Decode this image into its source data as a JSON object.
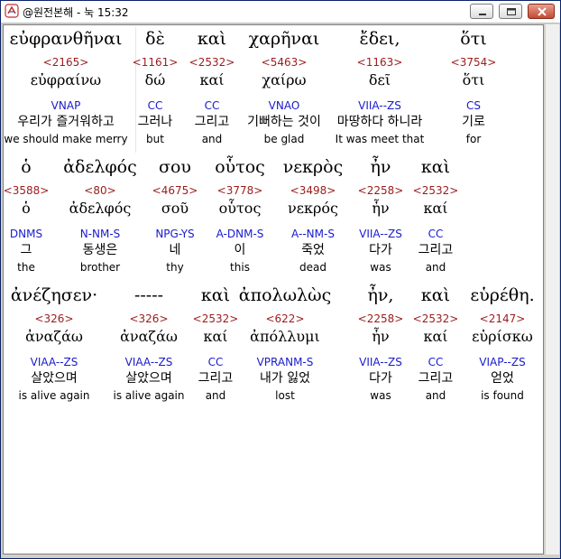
{
  "window": {
    "title": "@원전본해 - 눅 15:32"
  },
  "rows": [
    {
      "words": [
        {
          "greek": "εὐφρανθῆναι",
          "strong": "<2165>",
          "lemma": "εὐφραίνω",
          "parse": "VNAP",
          "korean": "우리가 즐거워하고",
          "english": "we should make merry"
        },
        {
          "greek": "δὲ",
          "strong": "<1161>",
          "lemma": "δώ",
          "parse": "CC",
          "korean": "그러나",
          "english": "but"
        },
        {
          "greek": "καὶ",
          "strong": "<2532>",
          "lemma": "καί",
          "parse": "CC",
          "korean": "그리고",
          "english": "and"
        },
        {
          "greek": "χαρῆναι",
          "strong": "<5463>",
          "lemma": "χαίρω",
          "parse": "VNAO",
          "korean": "기뻐하는 것이",
          "english": "be glad"
        },
        {
          "greek": "ἔδει,",
          "strong": "<1163>",
          "lemma": "δεῖ",
          "parse": "VIIA--ZS",
          "korean": "마땅하다 하니라",
          "english": "It was meet that"
        },
        {
          "greek": "ὅτι",
          "strong": "<3754>",
          "lemma": "ὅτι",
          "parse": "CS",
          "korean": "기로",
          "english": "for"
        }
      ]
    },
    {
      "words": [
        {
          "greek": "ὁ",
          "strong": "<3588>",
          "lemma": "ὁ",
          "parse": "DNMS",
          "korean": "그",
          "english": "the"
        },
        {
          "greek": "ἀδελφός",
          "strong": "<80>",
          "lemma": "ἀδελφός",
          "parse": "N-NM-S",
          "korean": "동생은",
          "english": "brother"
        },
        {
          "greek": "σου",
          "strong": "<4675>",
          "lemma": "σοῦ",
          "parse": "NPG-YS",
          "korean": "네",
          "english": "thy"
        },
        {
          "greek": "οὗτος",
          "strong": "<3778>",
          "lemma": "οὗτος",
          "parse": "A-DNM-S",
          "korean": "이",
          "english": "this"
        },
        {
          "greek": "νεκρὸς",
          "strong": "<3498>",
          "lemma": "νεκρός",
          "parse": "A--NM-S",
          "korean": "죽었",
          "english": "dead"
        },
        {
          "greek": "ἦν",
          "strong": "<2258>",
          "lemma": "ἦν",
          "parse": "VIIA--ZS",
          "korean": "다가",
          "english": "was"
        },
        {
          "greek": "καὶ",
          "strong": "<2532>",
          "lemma": "καί",
          "parse": "CC",
          "korean": "그리고",
          "english": "and"
        }
      ]
    },
    {
      "words": [
        {
          "greek": "ἀνέζησεν·",
          "strong": "<326>",
          "lemma": "ἀναζάω",
          "parse": "VIAA--ZS",
          "korean": "살았으며",
          "english": "is alive again"
        },
        {
          "greek": "-----",
          "strong": "<326>",
          "lemma": "ἀναζάω",
          "parse": "VIAA--ZS",
          "korean": "살았으며",
          "english": "is alive again"
        },
        {
          "greek": "καὶ",
          "strong": "<2532>",
          "lemma": "καί",
          "parse": "CC",
          "korean": "그리고",
          "english": "and"
        },
        {
          "greek": "ἀπολωλὼς",
          "strong": "<622>",
          "lemma": "ἀπόλλυμι",
          "parse": "VPRANM-S",
          "korean": "내가 잃었",
          "english": "lost"
        },
        {
          "greek": "ἦν,",
          "strong": "<2258>",
          "lemma": "ἦν",
          "parse": "VIIA--ZS",
          "korean": "다가",
          "english": "was"
        },
        {
          "greek": "καὶ",
          "strong": "<2532>",
          "lemma": "καί",
          "parse": "CC",
          "korean": "그리고",
          "english": "and"
        },
        {
          "greek": "εὑρέθη.",
          "strong": "<2147>",
          "lemma": "εὑρίσκω",
          "parse": "VIAP--ZS",
          "korean": "얻었",
          "english": "is found"
        }
      ]
    }
  ]
}
